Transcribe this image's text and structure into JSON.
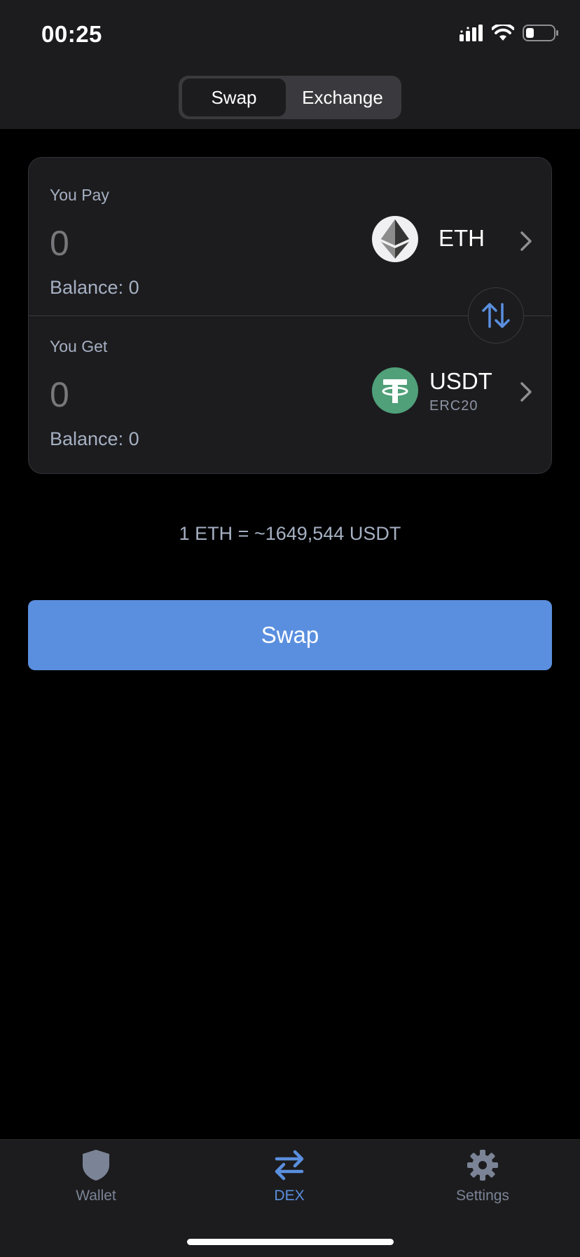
{
  "status_bar": {
    "time": "00:25"
  },
  "header": {
    "segments": [
      {
        "label": "Swap",
        "active": true
      },
      {
        "label": "Exchange",
        "active": false
      }
    ]
  },
  "pay": {
    "label": "You Pay",
    "amount": "0",
    "balance": "Balance: 0",
    "token": {
      "symbol": "ETH",
      "icon": "ethereum-icon"
    }
  },
  "get": {
    "label": "You Get",
    "amount": "0",
    "balance": "Balance: 0",
    "token": {
      "symbol": "USDT",
      "network": "ERC20",
      "icon": "tether-icon"
    }
  },
  "rate": "1 ETH = ~1649,544 USDT",
  "swap_button": "Swap",
  "tabs": [
    {
      "label": "Wallet",
      "icon": "shield-icon",
      "active": false
    },
    {
      "label": "DEX",
      "icon": "swap-arrows-icon",
      "active": true
    },
    {
      "label": "Settings",
      "icon": "gear-icon",
      "active": false
    }
  ],
  "colors": {
    "accent": "#5a8fdf",
    "background": "#000000",
    "surface": "#1c1c1e",
    "tether": "#50a07a"
  }
}
